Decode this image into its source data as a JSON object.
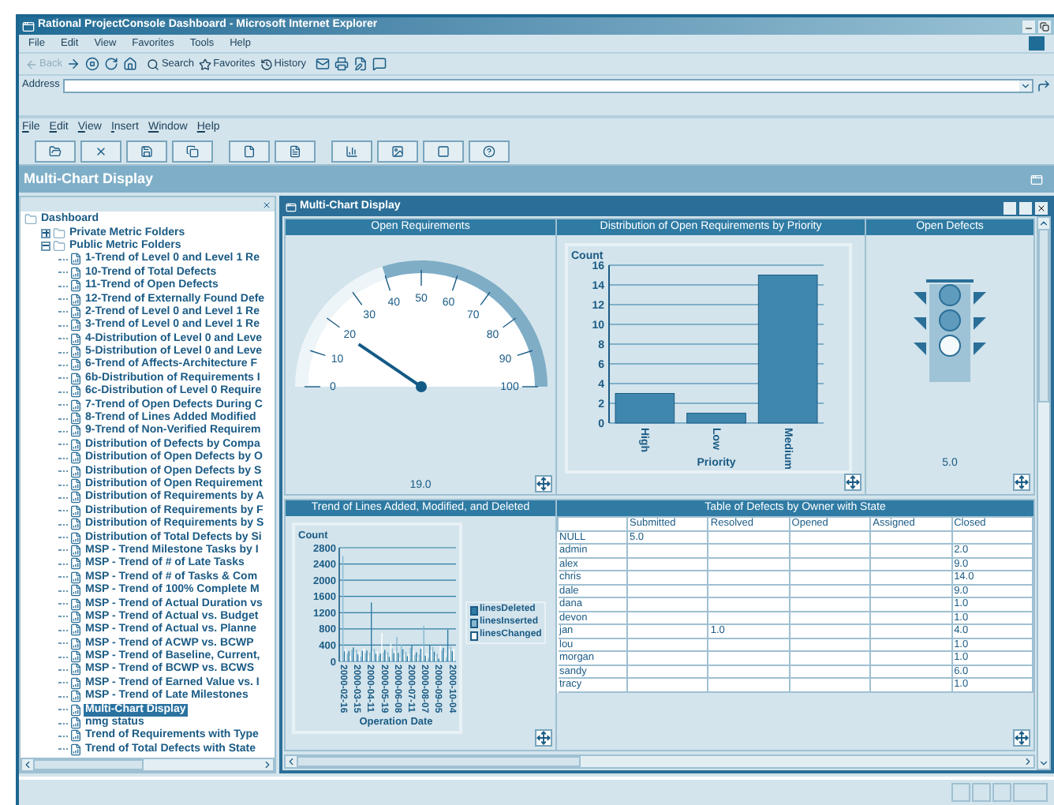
{
  "window": {
    "title": "Rational ProjectConsole Dashboard - Microsoft Internet Explorer"
  },
  "browser_menu": [
    "File",
    "Edit",
    "View",
    "Favorites",
    "Tools",
    "Help"
  ],
  "browser_toolbar": {
    "back": {
      "label": "Back",
      "disabled": true
    },
    "search": "Search",
    "favorites": "Favorites",
    "history": "History"
  },
  "address": {
    "label": "Address"
  },
  "app_menu": [
    "File",
    "Edit",
    "View",
    "Insert",
    "Window",
    "Help"
  ],
  "page_title": "Multi-Chart Display",
  "tree": [
    {
      "label": "Dashboard",
      "selected": false,
      "children": [
        {
          "label": "Private Metric Folders",
          "selected": false,
          "expanded": false
        },
        {
          "label": "Public Metric Folders",
          "selected": false,
          "expanded": true,
          "children": [
            {
              "label": "1-Trend of Level 0 and Level 1 Re",
              "selected": false
            },
            {
              "label": "10-Trend of Total Defects",
              "selected": false
            },
            {
              "label": "11-Trend of Open Defects",
              "selected": false
            },
            {
              "label": "12-Trend of Externally Found Defe",
              "selected": false
            },
            {
              "label": "2-Trend of Level 0 and Level 1 Re",
              "selected": false
            },
            {
              "label": "3-Trend of Level 0 and Level 1 Re",
              "selected": false
            },
            {
              "label": "4-Distribution of Level 0 and Leve",
              "selected": false
            },
            {
              "label": "5-Distribution of Level 0 and Leve",
              "selected": false
            },
            {
              "label": "6-Trend of Affects-Architecture F",
              "selected": false
            },
            {
              "label": "6b-Distribution of Requirements I",
              "selected": false
            },
            {
              "label": "6c-Distribution of Level 0 Require",
              "selected": false
            },
            {
              "label": "7-Trend of Open Defects During C",
              "selected": false
            },
            {
              "label": "8-Trend of Lines Added Modified",
              "selected": false
            },
            {
              "label": "9-Trend of Non-Verified Requirem",
              "selected": false
            },
            {
              "label": "Distribution of Defects by Compa",
              "selected": false
            },
            {
              "label": "Distribution of Open Defects by O",
              "selected": false
            },
            {
              "label": "Distribution of Open Defects by S",
              "selected": false
            },
            {
              "label": "Distribution of Open Requirement",
              "selected": false
            },
            {
              "label": "Distribution of Requirements by A",
              "selected": false
            },
            {
              "label": "Distribution of Requirements by F",
              "selected": false
            },
            {
              "label": "Distribution of Requirements by S",
              "selected": false
            },
            {
              "label": "Distribution of Total Defects by Si",
              "selected": false
            },
            {
              "label": "MSP - Trend Milestone Tasks by I",
              "selected": false
            },
            {
              "label": "MSP - Trend of # of Late Tasks",
              "selected": false
            },
            {
              "label": "MSP - Trend of # of Tasks & Com",
              "selected": false
            },
            {
              "label": "MSP - Trend of 100% Complete M",
              "selected": false
            },
            {
              "label": "MSP - Trend of Actual Duration vs",
              "selected": false
            },
            {
              "label": "MSP - Trend of Actual vs. Budget",
              "selected": false
            },
            {
              "label": "MSP - Trend of Actual vs. Planne",
              "selected": false
            },
            {
              "label": "MSP - Trend of ACWP vs. BCWP",
              "selected": false
            },
            {
              "label": "MSP - Trend of Baseline, Current,",
              "selected": false
            },
            {
              "label": "MSP - Trend of BCWP vs. BCWS",
              "selected": false
            },
            {
              "label": "MSP - Trend of Earned Value vs. I",
              "selected": false
            },
            {
              "label": "MSP - Trend of Late Milestones",
              "selected": false
            },
            {
              "label": "Multi-Chart Display",
              "selected": true
            },
            {
              "label": "nmg status",
              "selected": false
            },
            {
              "label": "Trend of Requirements with Type",
              "selected": false
            },
            {
              "label": "Trend of Total Defects with State",
              "selected": false
            }
          ]
        }
      ]
    }
  ],
  "inner_window": {
    "title": "Multi-Chart Display"
  },
  "gauge": {
    "title": "Open Requirements",
    "ticks": [
      "0",
      "10",
      "20",
      "30",
      "40",
      "50",
      "60",
      "70",
      "80",
      "90",
      "100"
    ],
    "reading": "19.0"
  },
  "priority_chart": {
    "title": "Distribution of Open Requirements by Priority",
    "chart_data": {
      "type": "bar",
      "grid": true,
      "xlabel": "Priority",
      "ylabel": "Count",
      "categories": [
        "High",
        "Low",
        "Medium"
      ],
      "values": [
        3,
        1,
        15
      ],
      "ylim": [
        0,
        16
      ],
      "yticks": [
        0,
        2,
        4,
        6,
        8,
        10,
        12,
        14,
        16
      ]
    }
  },
  "open_defects": {
    "title": "Open Defects",
    "lights": [
      {
        "on": false
      },
      {
        "on": false
      },
      {
        "on": true
      }
    ],
    "reading": "5.0"
  },
  "trend": {
    "title": "Trend of Lines Added, Modified, and Deleted",
    "ylabel": "Count",
    "yticks": [
      "2800",
      "2400",
      "2000",
      "1600",
      "1200",
      "800",
      "400",
      "0"
    ],
    "xticks": [
      "2000-02-16",
      "2000-03-15",
      "2000-04-11",
      "2000-05-19",
      "2000-06-08",
      "2000-07-11",
      "2000-08-07",
      "2000-09-05",
      "2000-10-04"
    ],
    "xlabel": "Operation Date",
    "legend": [
      {
        "label": "linesDeleted",
        "color": "#2e7ca5"
      },
      {
        "label": "linesInserted",
        "color": "#86b8d0"
      },
      {
        "label": "linesChanged",
        "color": "#ffffff"
      }
    ]
  },
  "defects_table": {
    "title": "Table of Defects by Owner with State",
    "columns": [
      "Submitted",
      "Resolved",
      "Opened",
      "Assigned",
      "Closed"
    ],
    "rows": [
      {
        "owner": "NULL",
        "cells": [
          "5.0",
          null,
          null,
          null,
          null
        ]
      },
      {
        "owner": "admin",
        "cells": [
          null,
          null,
          null,
          null,
          "2.0"
        ]
      },
      {
        "owner": "alex",
        "cells": [
          null,
          null,
          null,
          null,
          "9.0"
        ]
      },
      {
        "owner": "chris",
        "cells": [
          null,
          null,
          null,
          null,
          "14.0"
        ]
      },
      {
        "owner": "dale",
        "cells": [
          null,
          null,
          null,
          null,
          "9.0"
        ]
      },
      {
        "owner": "dana",
        "cells": [
          null,
          null,
          null,
          null,
          "1.0"
        ]
      },
      {
        "owner": "devon",
        "cells": [
          null,
          null,
          null,
          null,
          "1.0"
        ]
      },
      {
        "owner": "jan",
        "cells": [
          null,
          "1.0",
          null,
          null,
          "4.0"
        ]
      },
      {
        "owner": "lou",
        "cells": [
          null,
          null,
          null,
          null,
          "1.0"
        ]
      },
      {
        "owner": "morgan",
        "cells": [
          null,
          null,
          null,
          null,
          "1.0"
        ]
      },
      {
        "owner": "sandy",
        "cells": [
          null,
          null,
          null,
          null,
          "6.0"
        ]
      },
      {
        "owner": "tracy",
        "cells": [
          null,
          null,
          null,
          null,
          "1.0"
        ]
      }
    ]
  }
}
